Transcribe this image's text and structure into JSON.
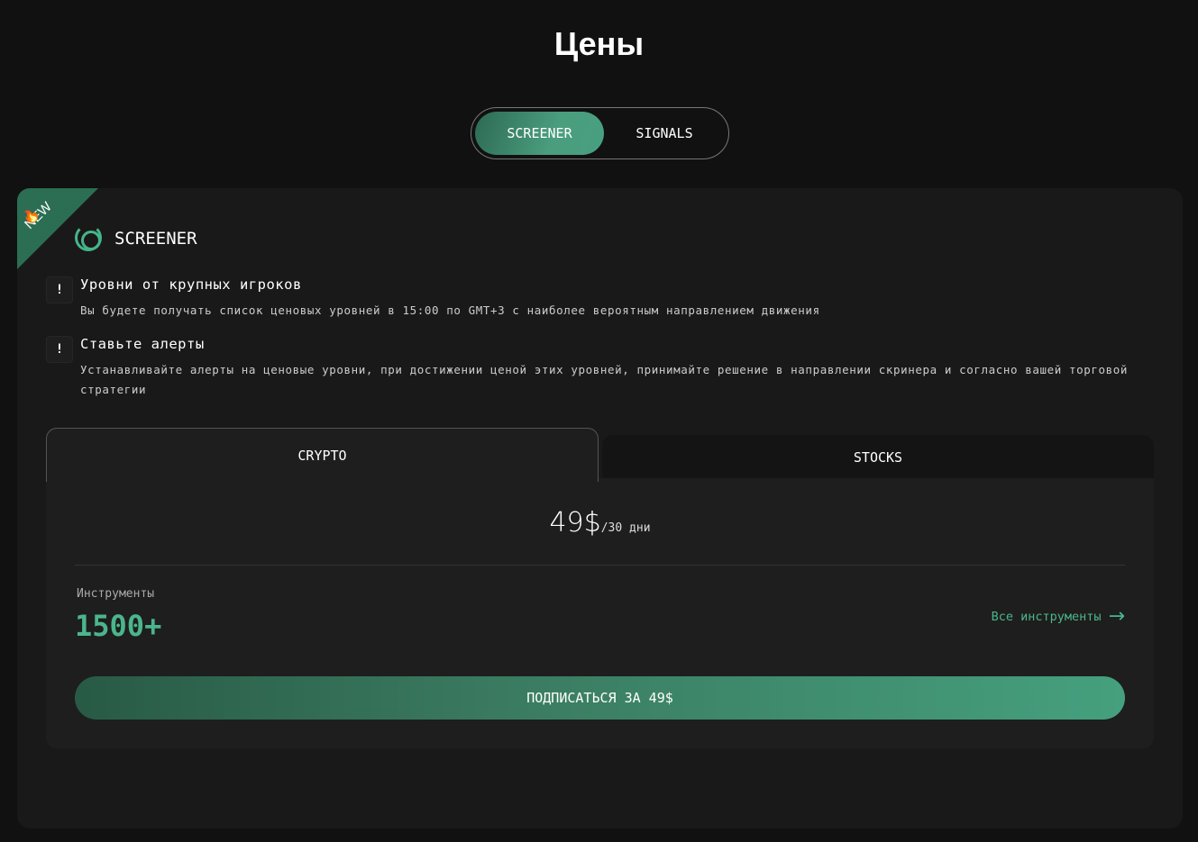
{
  "page": {
    "title": "Цены"
  },
  "switch": {
    "screener": "SCREENER",
    "signals": "SIGNALS"
  },
  "card": {
    "badge": "NEW",
    "badge_icon": "fire",
    "title": "SCREENER",
    "features": [
      {
        "title": "Уровни от крупных игроков",
        "text": "Вы будете получать список ценовых уровней в 15:00 по GMT+3 с наиболее вероятным направлением движения"
      },
      {
        "title": "Ставьте алерты",
        "text": "Устанавливайте алерты на ценовые уровни, при достижении ценой этих уровней, принимайте решение в направлении скринера и согласно вашей торговой стратегии"
      }
    ],
    "tabs": {
      "crypto": "CRYPTO",
      "stocks": "STOCKS"
    },
    "price": "49$",
    "period": "/30 дни",
    "instruments_label": "Инструменты",
    "instruments_count": "1500+",
    "all_instruments": "Все инструменты",
    "subscribe": "ПОДПИСАТЬСЯ ЗА 49$"
  },
  "colors": {
    "accent": "#4bb58c",
    "background": "#111111",
    "card": "#191919"
  }
}
